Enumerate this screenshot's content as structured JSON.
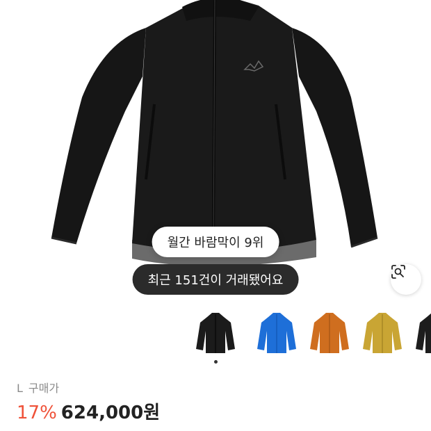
{
  "product": {
    "badges": {
      "rank": "월간 바람막이 9위",
      "recent_trades": "최근 151건이 거래됐어요"
    },
    "thumbnails": [
      {
        "color_name": "black",
        "color": "#1b1b1b",
        "selected": true
      },
      {
        "color_name": "blue",
        "color": "#1e6fd8",
        "selected": false
      },
      {
        "color_name": "orange",
        "color": "#cf6e1f",
        "selected": false
      },
      {
        "color_name": "yellow",
        "color": "#c9a534",
        "selected": false
      },
      {
        "color_name": "black-2",
        "color": "#1d1d1d",
        "selected": false
      }
    ],
    "size": "L",
    "price_label": "구매가",
    "discount": "17%",
    "price": "624,000원"
  },
  "colors": {
    "discount": "#ef5138",
    "dark_pill": "#2b2b2b"
  },
  "icons": {
    "lens_button": "image-search-icon"
  }
}
